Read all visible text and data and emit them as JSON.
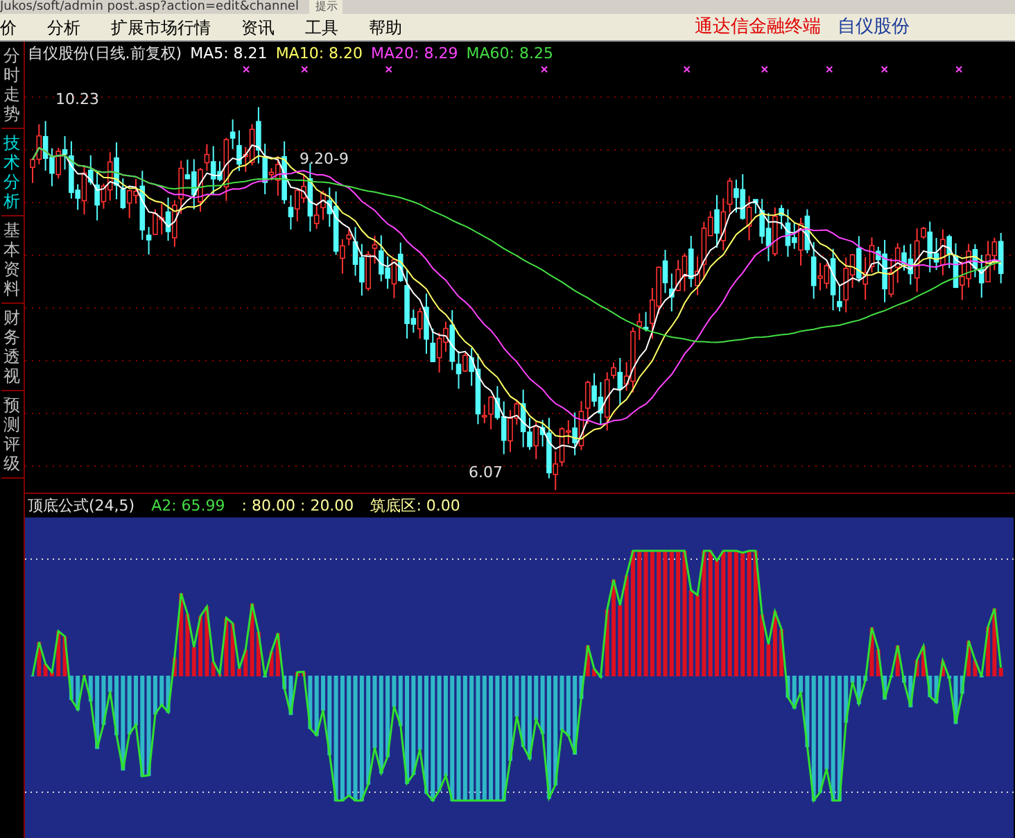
{
  "address_bar": {
    "url": "Jukos/soft/admin post.asp?action=edit&channel",
    "button": "提示"
  },
  "menu": [
    "价",
    "分析",
    "扩展市场行情",
    "资讯",
    "工具",
    "帮助"
  ],
  "app_name": "通达信金融终端",
  "stock_name": "自仪股份",
  "side_tabs": [
    {
      "label": "分时走势",
      "selected": false
    },
    {
      "label": "技术分析",
      "selected": true
    },
    {
      "label": "基本资料",
      "selected": false
    },
    {
      "label": "财务透视",
      "selected": false
    },
    {
      "label": "预测评级",
      "selected": false
    }
  ],
  "main_chart": {
    "legend": [
      {
        "text": "自仪股份(日线.前复权)",
        "color": "#e0e0e0"
      },
      {
        "text": "MA5: 8.21",
        "color": "#ffffff"
      },
      {
        "text": "MA10: 8.20",
        "color": "#ffff66"
      },
      {
        "text": "MA20: 8.29",
        "color": "#ff44ff"
      },
      {
        "text": "MA60: 8.25",
        "color": "#44dd44"
      }
    ],
    "high_label": "10.23",
    "mid_label": "9.20-9",
    "low_label": "6.07"
  },
  "indicator": {
    "legend": [
      {
        "text": "顶底公式(24,5)",
        "color": "#e0e0e0"
      },
      {
        "text": "A2: 65.99",
        "color": "#44dd44"
      },
      {
        "text": ": 80.00 : 20.00",
        "color": "#ffff99"
      },
      {
        "text": "筑底区: 0.00",
        "color": "#ffff99"
      }
    ]
  }
}
